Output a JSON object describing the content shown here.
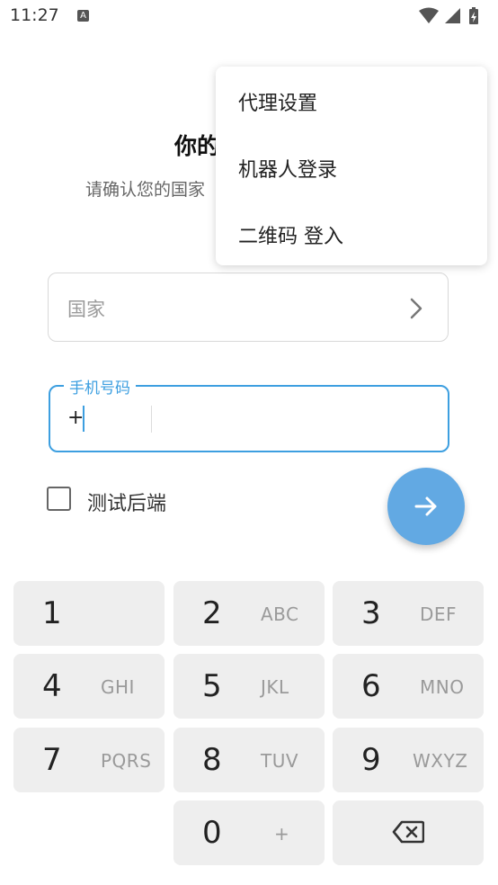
{
  "status_bar": {
    "time": "11:27",
    "notification_icon_letter": "A",
    "icons": [
      "wifi-icon",
      "signal-icon",
      "battery-charging-icon"
    ]
  },
  "header": {
    "title": "你的",
    "subtitle": "请确认您的国家"
  },
  "country_field": {
    "placeholder": "国家",
    "icon": "chevron-right-icon"
  },
  "phone_field": {
    "label": "手机号码",
    "country_code": "+",
    "value": ""
  },
  "test_backend": {
    "label": "测试后端",
    "checked": false
  },
  "fab": {
    "icon": "arrow-right-icon",
    "color": "#62a9e3"
  },
  "menu": {
    "items": [
      "代理设置",
      "机器人登录",
      "二维码 登入"
    ]
  },
  "keypad": {
    "keys": [
      {
        "digit": "1",
        "letters": ""
      },
      {
        "digit": "2",
        "letters": "ABC"
      },
      {
        "digit": "3",
        "letters": "DEF"
      },
      {
        "digit": "4",
        "letters": "GHI"
      },
      {
        "digit": "5",
        "letters": "JKL"
      },
      {
        "digit": "6",
        "letters": "MNO"
      },
      {
        "digit": "7",
        "letters": "PQRS"
      },
      {
        "digit": "8",
        "letters": "TUV"
      },
      {
        "digit": "9",
        "letters": "WXYZ"
      },
      {
        "digit": "0",
        "letters": "+"
      }
    ],
    "backspace_icon": "backspace-icon"
  },
  "colors": {
    "accent": "#3d9fe0",
    "key_background": "#eeeeee"
  }
}
